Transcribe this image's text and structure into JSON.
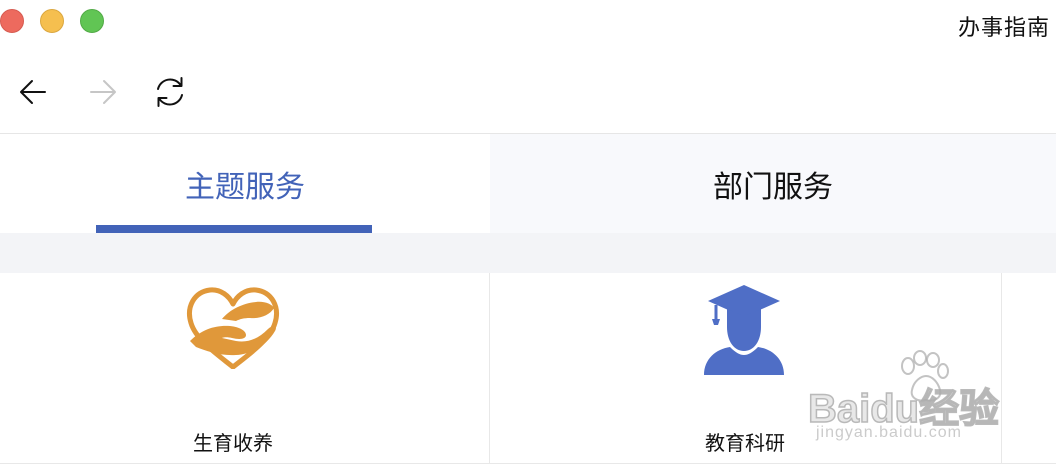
{
  "window": {
    "title": "办事指南",
    "controls": [
      "close",
      "minimize",
      "zoom"
    ]
  },
  "toolbar": {
    "back": {
      "icon": "arrow-left-icon",
      "enabled": true
    },
    "forward": {
      "icon": "arrow-right-icon",
      "enabled": false
    },
    "refresh": {
      "icon": "refresh-icon",
      "enabled": true
    }
  },
  "tabs": [
    {
      "label": "主题服务",
      "active": true
    },
    {
      "label": "部门服务",
      "active": false
    }
  ],
  "services": [
    {
      "label": "生育收养",
      "icon": "heart-hands-icon",
      "color": "#e0983a"
    },
    {
      "label": "教育科研",
      "icon": "graduate-icon",
      "color": "#4f6ec6"
    }
  ],
  "watermark": {
    "brand": "Baidu经验",
    "url": "jingyan.baidu.com"
  },
  "colors": {
    "accent": "#4263b8",
    "tab_inactive_bg": "#f8f9fc",
    "separator_bg": "#f3f4f7"
  }
}
